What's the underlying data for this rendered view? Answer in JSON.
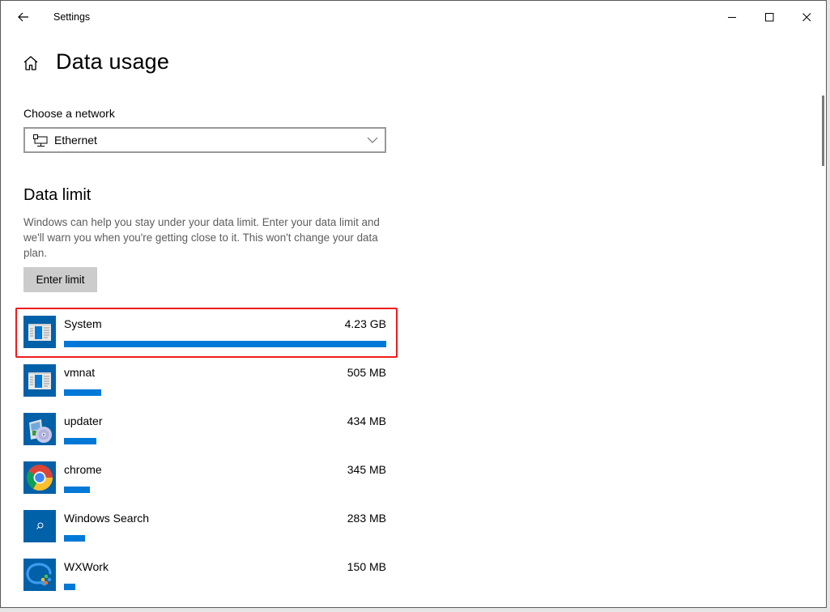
{
  "window": {
    "title": "Settings",
    "controls": {
      "minimize": "minimize",
      "maximize": "maximize",
      "close": "close"
    }
  },
  "page": {
    "title": "Data usage"
  },
  "network": {
    "label": "Choose a network",
    "selected": "Ethernet",
    "icon": "ethernet-icon"
  },
  "data_limit": {
    "title": "Data limit",
    "description": "Windows can help you stay under your data limit. Enter your data limit and we'll warn you when you're getting close to it. This won't change your data plan.",
    "button_label": "Enter limit"
  },
  "apps": [
    {
      "name": "System",
      "usage": "4.23 GB",
      "usage_mb": 4331,
      "icon": "system-app-icon",
      "highlighted": true
    },
    {
      "name": "vmnat",
      "usage": "505 MB",
      "usage_mb": 505,
      "icon": "system-app-icon",
      "highlighted": false
    },
    {
      "name": "updater",
      "usage": "434 MB",
      "usage_mb": 434,
      "icon": "installer-disc-icon",
      "highlighted": false
    },
    {
      "name": "chrome",
      "usage": "345 MB",
      "usage_mb": 345,
      "icon": "chrome-icon",
      "highlighted": false
    },
    {
      "name": "Windows Search",
      "usage": "283 MB",
      "usage_mb": 283,
      "icon": "search-icon",
      "highlighted": false
    },
    {
      "name": "WXWork",
      "usage": "150 MB",
      "usage_mb": 150,
      "icon": "wxwork-chat-icon",
      "highlighted": false
    }
  ],
  "colors": {
    "accent": "#0078d7",
    "tile": "#0060a8",
    "highlight": "#ee1c1c"
  }
}
